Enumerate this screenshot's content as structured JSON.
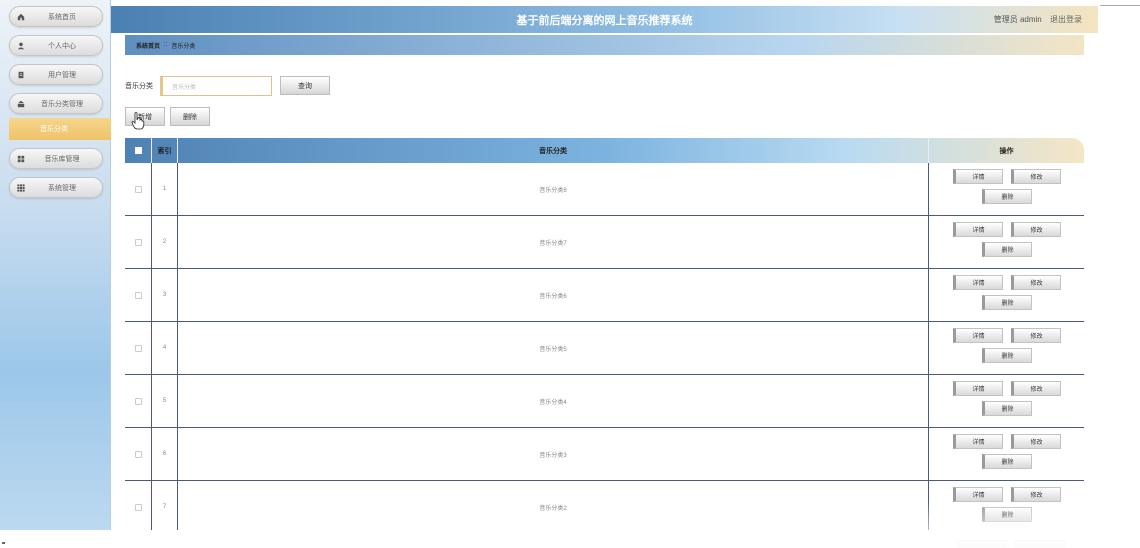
{
  "app": {
    "title": "基于前后端分离的网上音乐推荐系统",
    "user_label": "管理员 admin",
    "logout_label": "退出登录"
  },
  "sidebar": {
    "items": [
      {
        "label": "系统首页",
        "icon": "home-icon"
      },
      {
        "label": "个人中心",
        "icon": "user-icon"
      },
      {
        "label": "用户管理",
        "icon": "clipboard-icon"
      },
      {
        "label": "音乐分类管理",
        "icon": "bank-icon"
      },
      {
        "label": "音乐库管理",
        "icon": "grid-icon"
      },
      {
        "label": "系统管理",
        "icon": "grid-9-icon"
      }
    ],
    "active_sub": "音乐分类"
  },
  "breadcrumb": {
    "home": "系统首页",
    "separator": "::",
    "current": "音乐分类"
  },
  "search": {
    "label": "音乐分类",
    "placeholder": "音乐分类",
    "query_button": "查询"
  },
  "actions": {
    "add_label": "新增",
    "delete_label": "删除"
  },
  "table": {
    "headers": {
      "index": "索引",
      "name": "音乐分类",
      "ops": "操作"
    },
    "ops": {
      "detail": "详情",
      "edit": "修改",
      "delete": "删除"
    },
    "rows": [
      {
        "index": "1",
        "name": "音乐分类8"
      },
      {
        "index": "2",
        "name": "音乐分类7"
      },
      {
        "index": "3",
        "name": "音乐分类6"
      },
      {
        "index": "4",
        "name": "音乐分类5"
      },
      {
        "index": "5",
        "name": "音乐分类4"
      },
      {
        "index": "6",
        "name": "音乐分类3"
      },
      {
        "index": "7",
        "name": "音乐分类2"
      }
    ]
  },
  "colors": {
    "header_blue": "#4a80b2",
    "accent_gold": "#efc36a",
    "row_border": "#4c5a78"
  }
}
